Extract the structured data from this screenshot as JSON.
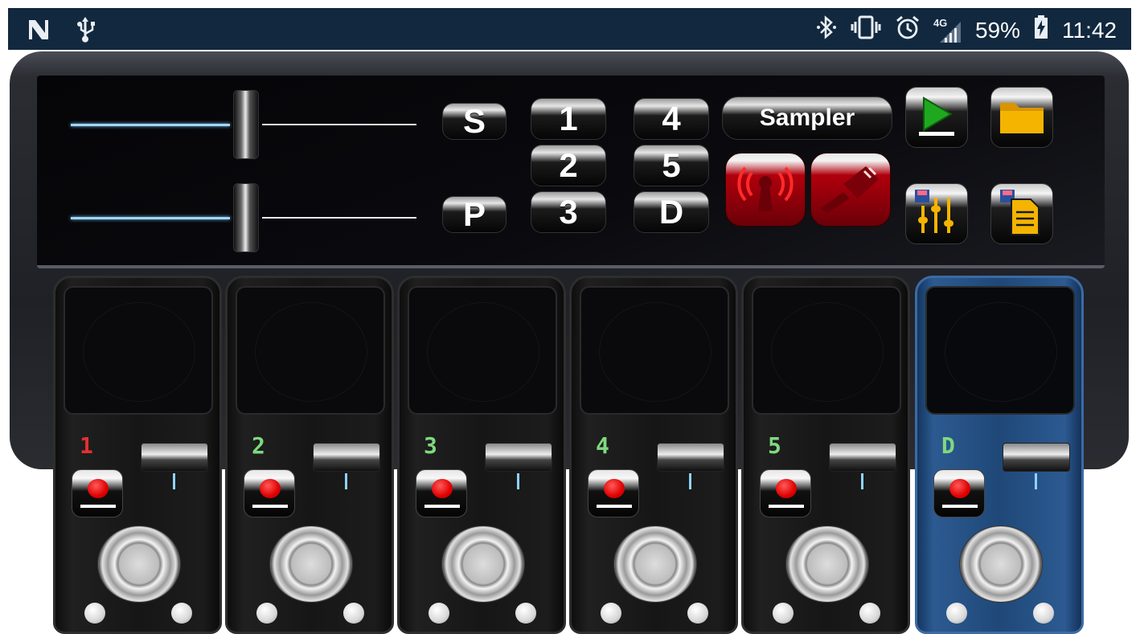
{
  "status_bar": {
    "left_icons": [
      "notification-n-icon",
      "usb-icon"
    ],
    "right_icons": [
      "bluetooth-icon",
      "vibrate-icon",
      "alarm-icon",
      "signal-4g-icon"
    ],
    "network": "4G",
    "battery": "59%",
    "time": "11:42"
  },
  "top_panel": {
    "sliders": [
      {
        "name": "upper-volume",
        "level": 0.47
      },
      {
        "name": "lower-volume",
        "level": 0.47
      }
    ],
    "letter_buttons": [
      "S",
      "P"
    ],
    "number_buttons": [
      "1",
      "2",
      "3",
      "4",
      "5",
      "D"
    ],
    "sampler_label": "Sampler",
    "icons": {
      "broadcast": "broadcast-tower-icon",
      "usb": "usb-plug-icon",
      "play": "play-icon",
      "folder": "folder-icon",
      "save_mixer": "save-mixer-icon",
      "save_file": "save-file-icon"
    },
    "colors": {
      "play": "#1fa81f",
      "folder": "#f4b400",
      "red_button": "#b0000c"
    }
  },
  "pedals": [
    {
      "label": "1",
      "label_color": "#e53030",
      "active": false
    },
    {
      "label": "2",
      "label_color": "#7fd97f",
      "active": false
    },
    {
      "label": "3",
      "label_color": "#7fd97f",
      "active": false
    },
    {
      "label": "4",
      "label_color": "#7fd97f",
      "active": false
    },
    {
      "label": "5",
      "label_color": "#7fd97f",
      "active": false
    },
    {
      "label": "D",
      "label_color": "#7fd97f",
      "active": true
    }
  ]
}
